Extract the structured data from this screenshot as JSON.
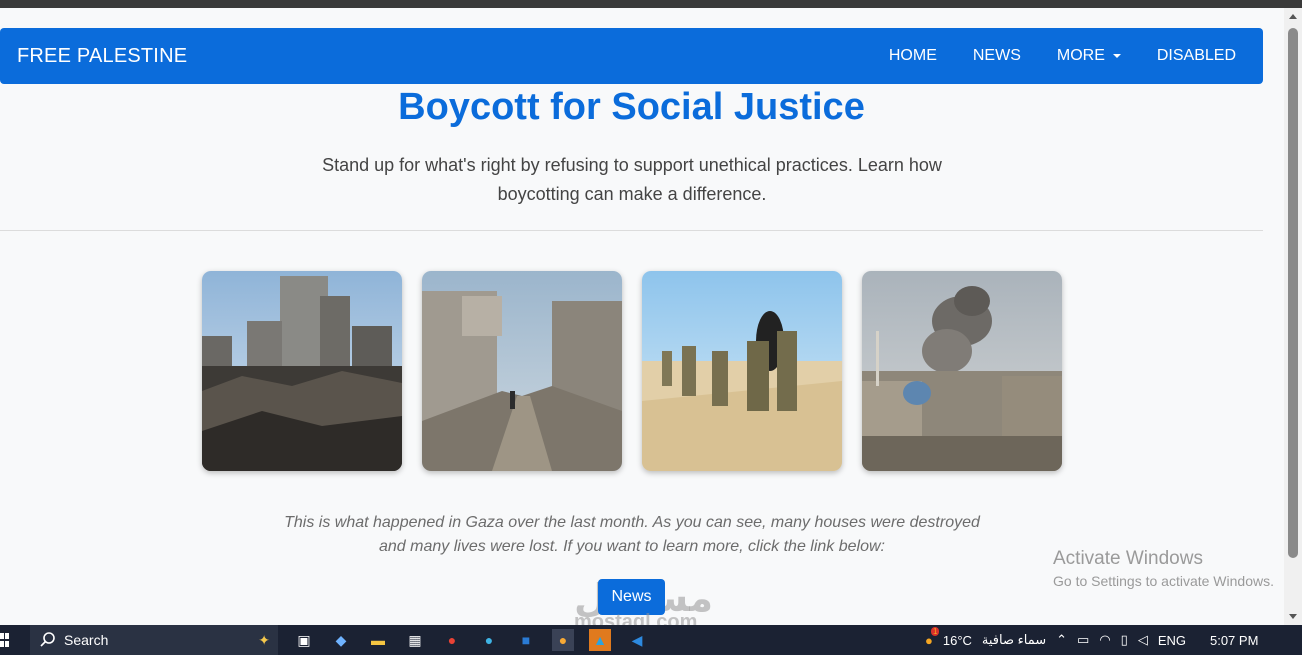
{
  "navbar": {
    "brand": "FREE PALESTINE",
    "links": [
      {
        "label": "HOME"
      },
      {
        "label": "NEWS"
      },
      {
        "label": "MORE"
      },
      {
        "label": "DISABLED"
      }
    ]
  },
  "hero": {
    "title": "Boycott for Social Justice",
    "text": "Stand up for what's right by refusing to support unethical practices. Learn how boycotting can make a difference."
  },
  "caption": "This is what happened in Gaza over the last month. As you can see, many houses were destroyed and many lives were lost. If you want to learn more, click the link below:",
  "news_button": "News",
  "windows_watermark": {
    "title": "Activate Windows",
    "subtitle": "Go to Settings to activate Windows."
  },
  "site_watermark": {
    "arabic": "مستقل",
    "latin": "mostaql.com"
  },
  "taskbar": {
    "search_label": "Search",
    "weather_temp": "16°C",
    "weather_text": "سماء صافية",
    "weather_badge": "1",
    "language": "ENG",
    "time": "5:07 PM"
  },
  "colors": {
    "primary": "#0b6cdb",
    "taskbar": "#1b2233"
  }
}
